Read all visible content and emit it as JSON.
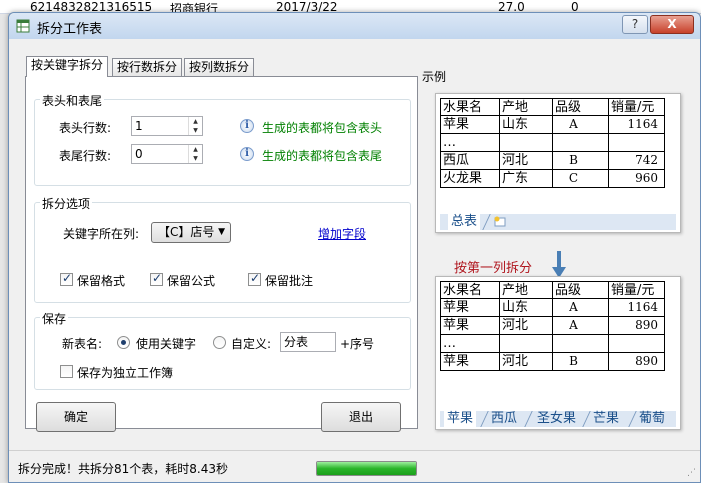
{
  "background_sheet": {
    "row_cells": [
      "6214832821316515",
      "招商银行",
      "2017/3/22",
      "27.0",
      "0"
    ]
  },
  "window": {
    "title": "拆分工作表",
    "help_button": "?",
    "close_button": "X"
  },
  "tabs": [
    {
      "label": "按关键字拆分",
      "active": true
    },
    {
      "label": "按行数拆分",
      "active": false
    },
    {
      "label": "按列数拆分",
      "active": false
    }
  ],
  "header_footer": {
    "group_label": "表头和表尾",
    "header_rows_label": "表头行数:",
    "header_rows_value": "1",
    "header_note": "生成的表都将包含表头",
    "footer_rows_label": "表尾行数:",
    "footer_rows_value": "0",
    "footer_note": "生成的表都将包含表尾"
  },
  "split_options": {
    "group_label": "拆分选项",
    "key_column_label": "关键字所在列:",
    "key_column_value": "【C】店号",
    "add_field_link": "增加字段",
    "keep_format": {
      "label": "保留格式",
      "checked": true
    },
    "keep_formula": {
      "label": "保留公式",
      "checked": true
    },
    "keep_comment": {
      "label": "保留批注",
      "checked": true
    }
  },
  "save": {
    "group_label": "保存",
    "sheet_name_label": "新表名:",
    "use_keyword": {
      "label": "使用关键字",
      "checked": true
    },
    "custom": {
      "label": "自定义:",
      "checked": false
    },
    "custom_value": "分表",
    "suffix_label": "+序号",
    "standalone": {
      "label": "保存为独立工作簿",
      "checked": false
    }
  },
  "buttons": {
    "ok": "确定",
    "exit": "退出"
  },
  "example": {
    "label": "示例",
    "headers": [
      "水果名",
      "产地",
      "品级",
      "销量/元"
    ],
    "top_rows": [
      [
        "苹果",
        "山东",
        "A",
        "1164"
      ],
      [
        "…",
        "",
        "",
        ""
      ],
      [
        "西瓜",
        "河北",
        "B",
        "742"
      ],
      [
        "火龙果",
        "广东",
        "C",
        "960"
      ]
    ],
    "top_tabs": [
      "总表"
    ],
    "split_note": "按第一列拆分",
    "bottom_rows": [
      [
        "苹果",
        "山东",
        "A",
        "1164"
      ],
      [
        "苹果",
        "河北",
        "A",
        "890"
      ],
      [
        "…",
        "",
        "",
        ""
      ],
      [
        "苹果",
        "河北",
        "B",
        "890"
      ]
    ],
    "bottom_tabs": [
      "苹果",
      "西瓜",
      "圣女果",
      "芒果",
      "葡萄"
    ]
  },
  "status": {
    "text": "拆分完成！共拆分81个表，耗时8.43秒",
    "progress": 1.0
  },
  "colors": {
    "note_green": "#008000",
    "link_blue": "#0000cc",
    "split_note_red": "#b0171f",
    "progress_green": "#2bb52b"
  }
}
